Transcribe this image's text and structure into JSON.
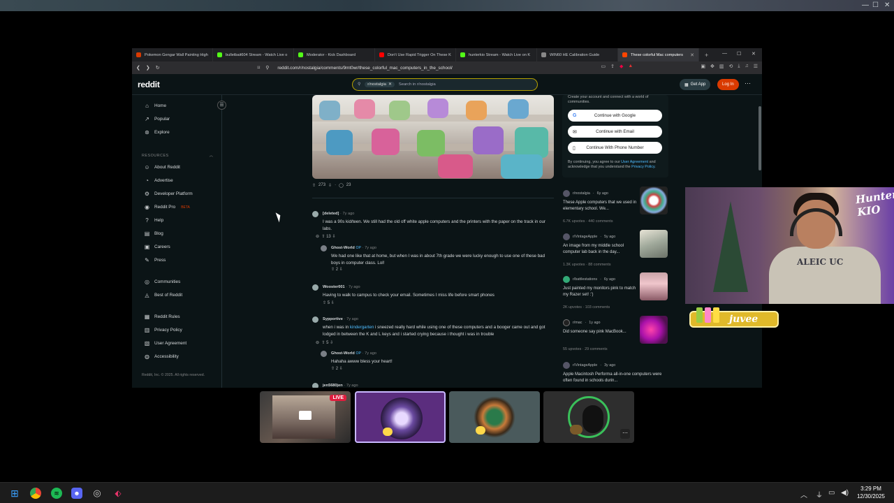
{
  "browser": {
    "tabs": [
      {
        "title": "Pokemon Gengar Wall Painting High",
        "color": "#d93a00"
      },
      {
        "title": "bulletbait604 Stream - Watch Live o",
        "color": "#53fc18"
      },
      {
        "title": "Moderator - Kick Dashboard",
        "color": "#53fc18"
      },
      {
        "title": "Don't Use Rapid Trigger On These K",
        "color": "#ff0000"
      },
      {
        "title": "hunterkio Stream - Watch Live on K",
        "color": "#53fc18"
      },
      {
        "title": "WIN60 HE Calibration Guide",
        "color": "#888888"
      },
      {
        "title": "These colorful Mac computers",
        "color": "#ff4500"
      }
    ],
    "url": "reddit.com/r/nostalgia/comments/9mt0wr/these_colorful_mac_computers_in_the_school/"
  },
  "header": {
    "logo": "reddit",
    "search_chip": "r/nostalgia",
    "search_placeholder": "Search in r/nostalgia",
    "get_app": "Get App",
    "login": "Log In"
  },
  "sidebar": {
    "items": [
      {
        "label": "Home",
        "icon": "⌂"
      },
      {
        "label": "Popular",
        "icon": "↗"
      },
      {
        "label": "Explore",
        "icon": "⊛"
      }
    ],
    "resources_heading": "RESOURCES",
    "resources": [
      {
        "label": "About Reddit",
        "icon": "☺"
      },
      {
        "label": "Advertise",
        "icon": "◔"
      },
      {
        "label": "Developer Platform",
        "icon": "⚙"
      },
      {
        "label": "Reddit Pro",
        "icon": "◉",
        "badge": "BETA"
      },
      {
        "label": "Help",
        "icon": "?"
      },
      {
        "label": "Blog",
        "icon": "▤"
      },
      {
        "label": "Careers",
        "icon": "▣"
      },
      {
        "label": "Press",
        "icon": "✎"
      }
    ],
    "community": [
      {
        "label": "Communities",
        "icon": "◎"
      },
      {
        "label": "Best of Reddit",
        "icon": "◬"
      }
    ],
    "legal": [
      {
        "label": "Reddit Rules",
        "icon": "▦"
      },
      {
        "label": "Privacy Policy",
        "icon": "▥"
      },
      {
        "label": "User Agreement",
        "icon": "▧"
      },
      {
        "label": "Accessibility",
        "icon": "◍"
      }
    ],
    "copyright": "Reddit, Inc. © 2025. All rights reserved."
  },
  "post": {
    "votes": "273",
    "comments": "23"
  },
  "comments": [
    {
      "user": "[deleted]",
      "age": "7y ago",
      "body": "I was a 90s kid/teen. We still had the old off white apple computers and the printers with the paper on the track in our labs.",
      "votes": "13"
    },
    {
      "user": "Ghost-World",
      "op": "OP",
      "age": "7y ago",
      "body": "We had one like that at home, but when I was in about 7th grade we were lucky enough to use one of these bad boys in computer class. Lol!",
      "votes": "2"
    },
    {
      "user": "Wooster001",
      "age": "7y ago",
      "body": "Having to walk to campus to check your email. Sometimes I miss life before smart phones",
      "votes": "5"
    },
    {
      "user": "Sypportive",
      "age": "7y ago",
      "body_pre": "when i was in ",
      "link": "kindergarten",
      "body_post": " i sneezed really hard while using one of these computers and a booger came out and got lodged in between the K and L keys and i started crying because i thought i was in trouble",
      "votes": "5"
    },
    {
      "user": "Ghost-World",
      "op": "OP",
      "age": "7y ago",
      "body": "Hahaha awww bless your heart!",
      "votes": "2"
    },
    {
      "user": "jen5680jen",
      "age": "7y ago"
    }
  ],
  "auth": {
    "intro": "Create your account and connect with a world of communities.",
    "google": "Continue with Google",
    "email": "Continue with Email",
    "phone": "Continue With Phone Number",
    "terms_pre": "By continuing, you agree to our ",
    "terms_link1": "User Agreement",
    "terms_mid": " and acknowledge that you understand the ",
    "terms_link2": "Privacy Policy",
    "terms_end": "."
  },
  "related": [
    {
      "sub": "r/nostalgia",
      "age": "6y ago",
      "title": "These Apple computers that we used in elementary school. We...",
      "upvotes": "6.7K upvotes",
      "comments": "440 comments"
    },
    {
      "sub": "r/VintageApple",
      "age": "5y ago",
      "title": "An image from my middle school computer lab back in the day...",
      "upvotes": "1.3K upvotes",
      "comments": "88 comments"
    },
    {
      "sub": "r/battlestations",
      "age": "6y ago",
      "title": "Just painted my monitors pink to match my Razer set! :')",
      "upvotes": "2K upvotes",
      "comments": "103 comments"
    },
    {
      "sub": "r/mac",
      "age": "1y ago",
      "title": "Did someone say pink MacBook...",
      "upvotes": "55 upvotes",
      "comments": "29 comments"
    },
    {
      "sub": "r/VintageApple",
      "age": "3y ago",
      "title": "Apple Macintosh Performa all-in-one computers were often found in schools durin...",
      "upvotes": "",
      "comments": ""
    }
  ],
  "overlay": {
    "hunter_logo": "Hunter KIO",
    "shirt_text": "ALEIC UC",
    "sponsor": "juvee"
  },
  "tiles": {
    "live_badge": "LIVE",
    "more": "⋯"
  },
  "taskbar": {
    "time": "3:29 PM",
    "date": "12/30/2025"
  }
}
